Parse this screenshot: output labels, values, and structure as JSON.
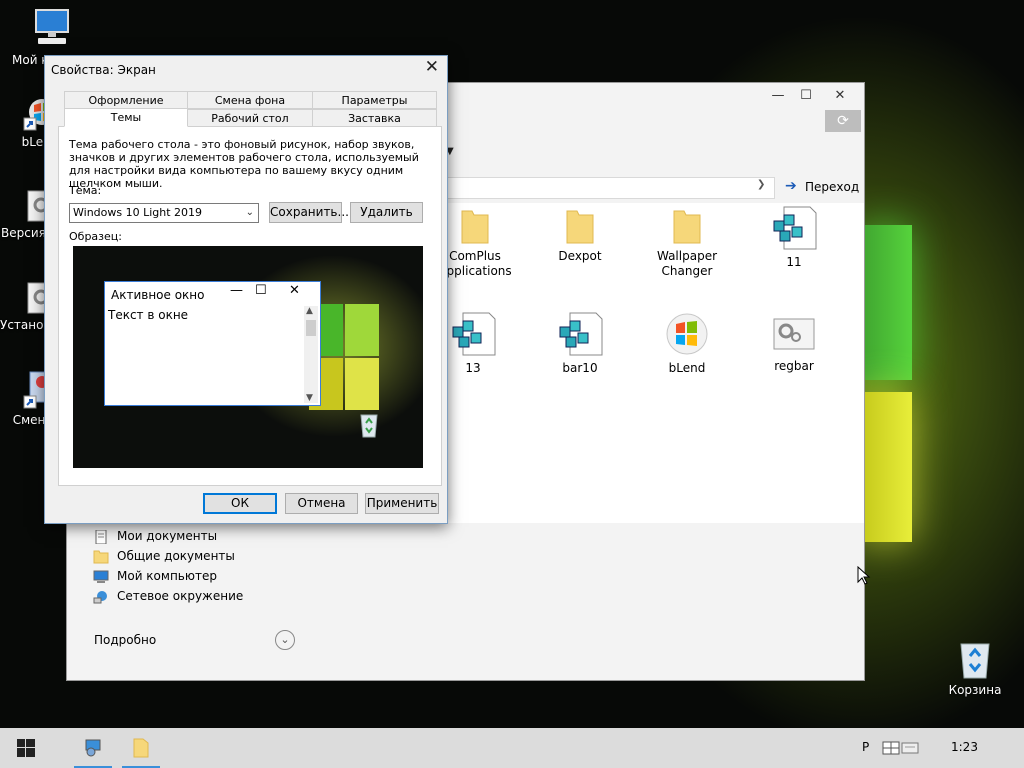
{
  "desktop": {
    "icons": [
      {
        "label": "Мой компьютер",
        "name": "my-computer"
      },
      {
        "label": "bLend",
        "name": "blend-shortcut"
      },
      {
        "label": "Версия Shell",
        "name": "shell-version"
      },
      {
        "label": "Установка обновлений",
        "name": "install-updates"
      },
      {
        "label": "Сменить",
        "name": "change-shortcut"
      }
    ],
    "recycle_bin": "Корзина"
  },
  "explorer": {
    "controls": {
      "minimize": "—",
      "maximize": "☐",
      "close": "✕"
    },
    "go_label": "Переход",
    "items": [
      {
        "label": "ComPlus Applications",
        "icon": "folder-icon"
      },
      {
        "label": "Dexpot",
        "icon": "folder-icon"
      },
      {
        "label": "Wallpaper Changer",
        "icon": "folder-icon"
      },
      {
        "label": "11",
        "icon": "registry-file-icon"
      },
      {
        "label": "13",
        "icon": "registry-file-icon"
      },
      {
        "label": "bar10",
        "icon": "registry-file-icon"
      },
      {
        "label": "bLend",
        "icon": "blend-icon"
      },
      {
        "label": "regbar",
        "icon": "settings-file-icon"
      }
    ],
    "tasks": [
      {
        "label": "Мои документы",
        "icon": "documents-icon"
      },
      {
        "label": "Общие документы",
        "icon": "folder-icon"
      },
      {
        "label": "Мой компьютер",
        "icon": "computer-icon"
      },
      {
        "label": "Сетевое окружение",
        "icon": "network-icon"
      }
    ],
    "details_label": "Подробно"
  },
  "dialog": {
    "title": "Свойства: Экран",
    "tabs_back": [
      "Оформление",
      "Смена фона",
      "Параметры"
    ],
    "tabs_front": [
      "Темы",
      "Рабочий стол",
      "Заставка"
    ],
    "description": "Тема рабочего стола - это фоновый рисунок, набор звуков, значков и других элементов рабочего стола, используемый для настройки вида компьютера по вашему вкусу одним щелчком мыши.",
    "theme_label": "Тема:",
    "theme_value": "Windows 10 Light 2019",
    "save_button": "Сохранить...",
    "delete_button": "Удалить",
    "sample_label": "Образец:",
    "preview": {
      "active_window_title": "Активное окно",
      "window_text": "Текст в окне"
    },
    "ok_button": "ОК",
    "cancel_button": "Отмена",
    "apply_button": "Применить"
  },
  "taskbar": {
    "lang": "Р",
    "clock": "1:23"
  }
}
